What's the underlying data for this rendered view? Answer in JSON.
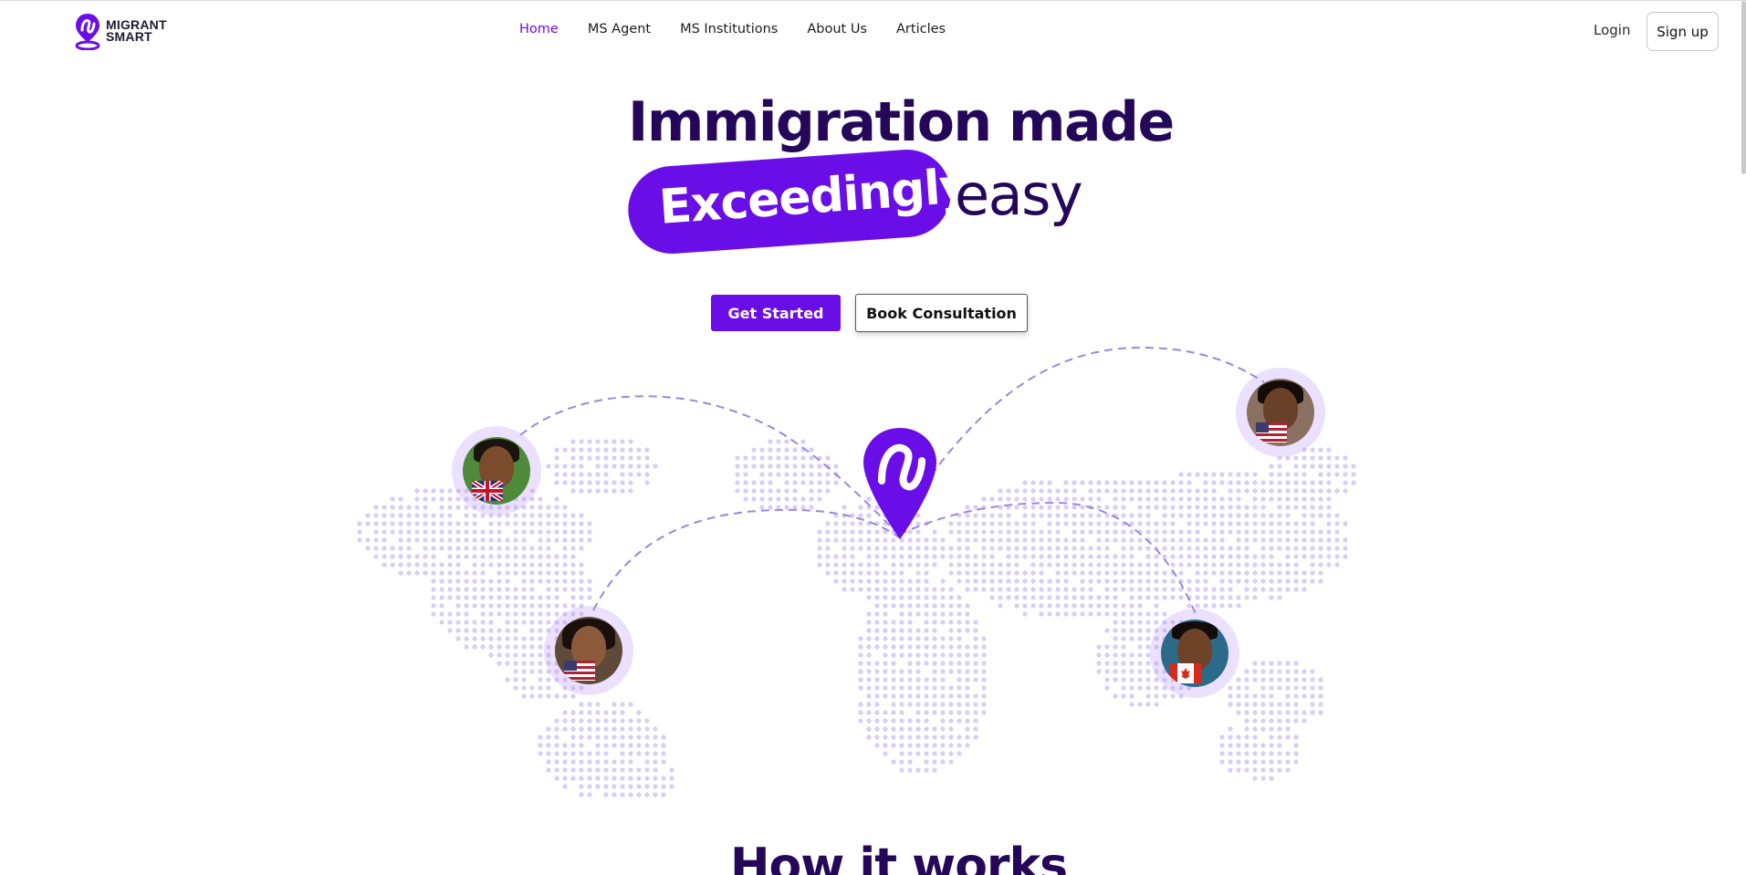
{
  "brand": {
    "name_line1": "MIGRANT",
    "name_line2": "SMART",
    "accent_color": "#6a0ee8",
    "heading_color": "#25075a"
  },
  "nav": {
    "items": [
      {
        "label": "Home",
        "active": true
      },
      {
        "label": "MS Agent",
        "active": false
      },
      {
        "label": "MS Institutions",
        "active": false
      },
      {
        "label": "About Us",
        "active": false
      },
      {
        "label": "Articles",
        "active": false
      }
    ],
    "login_label": "Login",
    "signup_label": "Sign up"
  },
  "hero": {
    "title_line1": "Immigration made",
    "highlight_word": "Exceedingly",
    "title_end": "easy",
    "primary_cta": "Get Started",
    "secondary_cta": "Book Consultation"
  },
  "map": {
    "center_pin_icon": "migrant-smart-pin-icon",
    "avatars": [
      {
        "id": "uk",
        "flag_icon": "uk-flag-icon"
      },
      {
        "id": "usa-woman",
        "flag_icon": "usa-flag-icon"
      },
      {
        "id": "usa-man",
        "flag_icon": "usa-flag-icon"
      },
      {
        "id": "canada",
        "flag_icon": "canada-flag-icon"
      }
    ]
  },
  "how_it_works": {
    "title": "How it works"
  }
}
